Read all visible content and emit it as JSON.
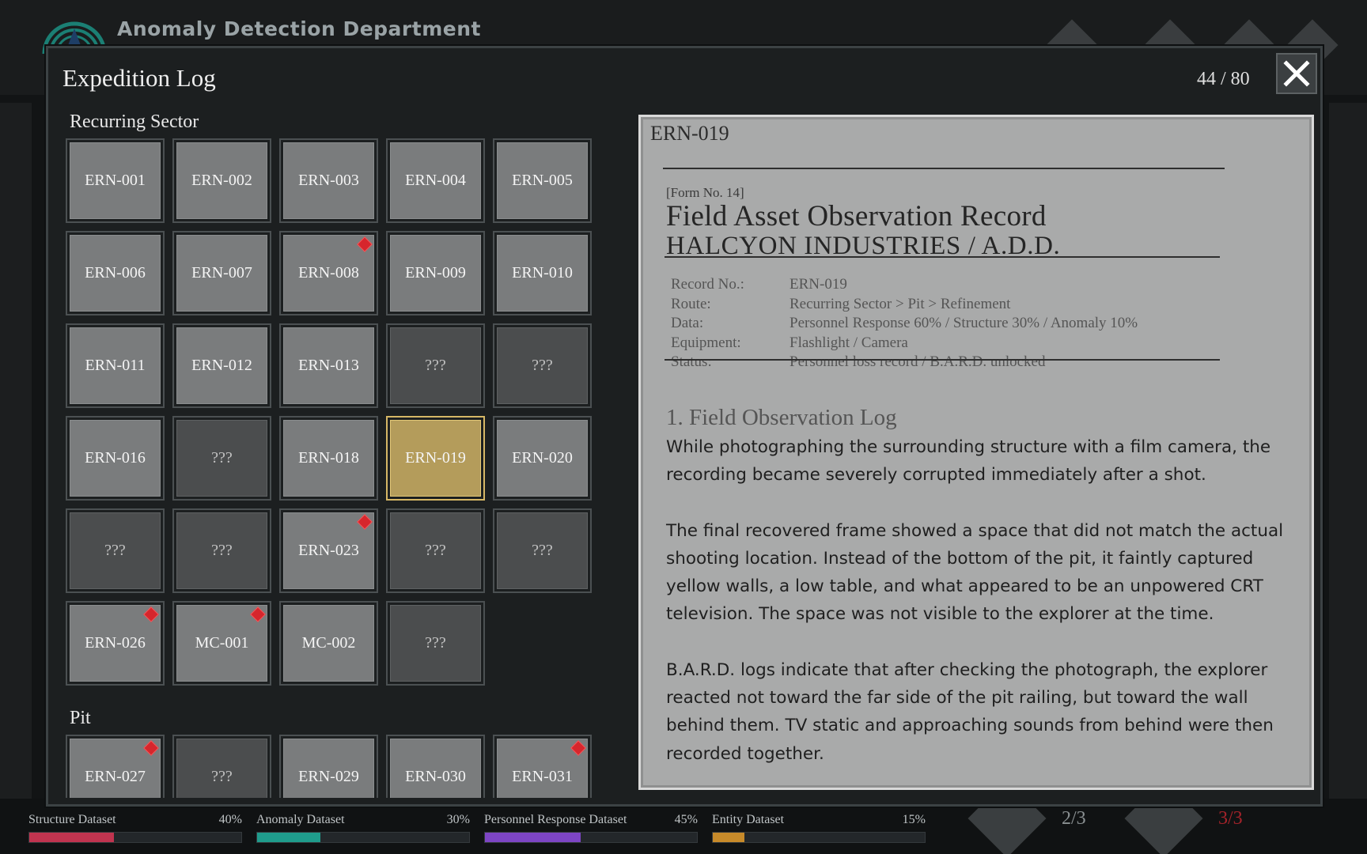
{
  "app": {
    "title": "Anomaly Detection Department"
  },
  "modal": {
    "title": "Expedition Log",
    "counter": "44 / 80",
    "close_icon": "close-icon"
  },
  "sections": [
    {
      "label": "Recurring Sector",
      "entries": [
        {
          "label": "ERN-001",
          "state": "known",
          "flag": false
        },
        {
          "label": "ERN-002",
          "state": "known",
          "flag": false
        },
        {
          "label": "ERN-003",
          "state": "known",
          "flag": false
        },
        {
          "label": "ERN-004",
          "state": "known",
          "flag": false
        },
        {
          "label": "ERN-005",
          "state": "known",
          "flag": false
        },
        {
          "label": "ERN-006",
          "state": "known",
          "flag": false
        },
        {
          "label": "ERN-007",
          "state": "known",
          "flag": false
        },
        {
          "label": "ERN-008",
          "state": "known",
          "flag": true
        },
        {
          "label": "ERN-009",
          "state": "known",
          "flag": false
        },
        {
          "label": "ERN-010",
          "state": "known",
          "flag": false
        },
        {
          "label": "ERN-011",
          "state": "known",
          "flag": false
        },
        {
          "label": "ERN-012",
          "state": "known",
          "flag": false
        },
        {
          "label": "ERN-013",
          "state": "known",
          "flag": false
        },
        {
          "label": "???",
          "state": "unknown",
          "flag": false
        },
        {
          "label": "???",
          "state": "unknown",
          "flag": false
        },
        {
          "label": "ERN-016",
          "state": "known",
          "flag": false
        },
        {
          "label": "???",
          "state": "unknown",
          "flag": false
        },
        {
          "label": "ERN-018",
          "state": "known",
          "flag": false
        },
        {
          "label": "ERN-019",
          "state": "selected",
          "flag": false
        },
        {
          "label": "ERN-020",
          "state": "known",
          "flag": false
        },
        {
          "label": "???",
          "state": "unknown",
          "flag": false
        },
        {
          "label": "???",
          "state": "unknown",
          "flag": false
        },
        {
          "label": "ERN-023",
          "state": "known",
          "flag": true
        },
        {
          "label": "???",
          "state": "unknown",
          "flag": false
        },
        {
          "label": "???",
          "state": "unknown",
          "flag": false
        },
        {
          "label": "ERN-026",
          "state": "known",
          "flag": true
        },
        {
          "label": "MC-001",
          "state": "known",
          "flag": true
        },
        {
          "label": "MC-002",
          "state": "known",
          "flag": false
        },
        {
          "label": "???",
          "state": "unknown",
          "flag": false
        }
      ]
    },
    {
      "label": "Pit",
      "entries": [
        {
          "label": "ERN-027",
          "state": "known",
          "flag": true
        },
        {
          "label": "???",
          "state": "unknown",
          "flag": false
        },
        {
          "label": "ERN-029",
          "state": "known",
          "flag": false
        },
        {
          "label": "ERN-030",
          "state": "known",
          "flag": false
        },
        {
          "label": "ERN-031",
          "state": "known",
          "flag": true
        }
      ]
    }
  ],
  "document": {
    "id": "ERN-019",
    "form_no": "[Form No. 14]",
    "title_line1": "Field Asset Observation Record",
    "title_line2": "HALCYON INDUSTRIES / A.D.D.",
    "meta": [
      {
        "key": "Record No.:",
        "value": "ERN-019"
      },
      {
        "key": "Route:",
        "value": "Recurring Sector > Pit > Refinement"
      },
      {
        "key": "Data:",
        "value": "Personnel Response 60% / Structure 30% / Anomaly 10%"
      },
      {
        "key": "Equipment:",
        "value": "Flashlight / Camera"
      },
      {
        "key": "Status:",
        "value": "Personnel loss record / B.A.R.D. unlocked"
      }
    ],
    "log_heading": "1. Field Observation Log",
    "paragraphs": [
      "While photographing the surrounding structure with a film camera, the recording became severely corrupted immediately after a shot.",
      "The final recovered frame showed a space that did not match the actual shooting location. Instead of the bottom of the pit, it faintly captured yellow walls, a low table, and what appeared to be an unpowered CRT television. The space was not visible to the explorer at the time.",
      "B.A.R.D. logs indicate that after checking the photograph, the explorer reacted not toward the far side of the pit railing, but toward the wall behind them. TV static and approaching sounds from behind were then recorded together."
    ]
  },
  "datasets": [
    {
      "label": "Structure Dataset",
      "value": "40%",
      "fraction": 0.4,
      "color": "#c0344f"
    },
    {
      "label": "Anomaly Dataset",
      "value": "30%",
      "fraction": 0.3,
      "color": "#1f9c8c"
    },
    {
      "label": "Personnel Response Dataset",
      "value": "45%",
      "fraction": 0.45,
      "color": "#7d45c4"
    },
    {
      "label": "Entity Dataset",
      "value": "15%",
      "fraction": 0.15,
      "color": "#c78a2a"
    }
  ],
  "footer": {
    "page_a": "2/3",
    "page_b": "3/3",
    "page_a_color": "#8a9092",
    "page_b_color": "#a4232a"
  },
  "colors": {
    "selected_cell": "#b49c5b",
    "flag": "#d6262c"
  }
}
